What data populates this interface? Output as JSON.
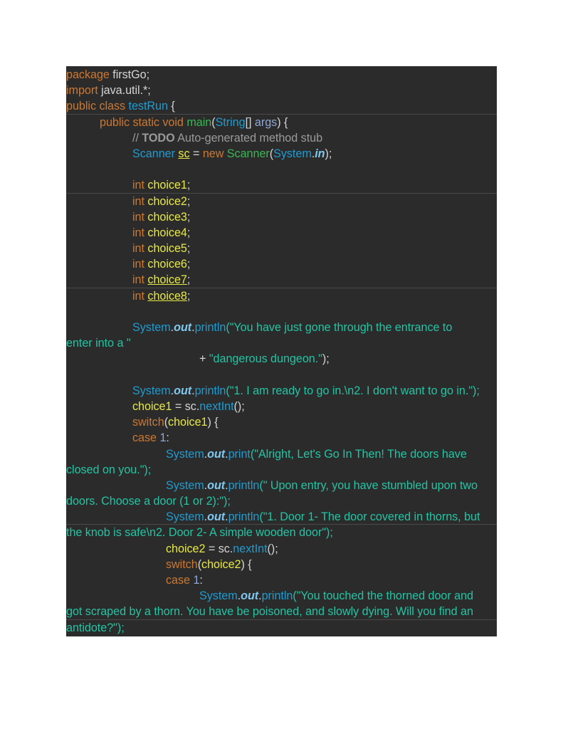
{
  "code": {
    "l01": {
      "kw": "package",
      "rest": " firstGo;"
    },
    "l02": {
      "kw": "import",
      "rest": " java.util.*;"
    },
    "l03": {
      "kw": "public class",
      "cls": " testRun",
      "rest": " {"
    },
    "l04": {
      "kw": "public static void",
      "m": " main",
      "p1": "(",
      "ty": "String",
      "p2": "[] ",
      "arg": "args",
      "p3": ") {"
    },
    "l05": {
      "c1": "// ",
      "todo": "TODO",
      "c2": " Auto-generated method stub"
    },
    "l06": {
      "ty": "Scanner",
      "sp": " ",
      "var": "sc",
      "eq": " = ",
      "kw": "new",
      "m": " Scanner",
      "p1": "(",
      "sys": "System",
      "dot": ".",
      "in": "in",
      "p2": ");"
    },
    "choices": [
      {
        "kw": "int",
        "var": "choice1",
        "semi": ";"
      },
      {
        "kw": "int",
        "var": "choice2",
        "semi": ";"
      },
      {
        "kw": "int",
        "var": "choice3",
        "semi": ";"
      },
      {
        "kw": "int",
        "var": "choice4",
        "semi": ";"
      },
      {
        "kw": "int",
        "var": "choice5",
        "semi": ";"
      },
      {
        "kw": "int",
        "var": "choice6",
        "semi": ";"
      },
      {
        "kw": "int",
        "var": "choice7",
        "semi": ";"
      },
      {
        "kw": "int",
        "var": "choice8",
        "semi": ";"
      }
    ],
    "sys": "System",
    "dot": ".",
    "out": "out",
    "println": "println",
    "print": "print",
    "l16a": "(\"You have just gone through the entrance to",
    "l16b": "enter into a \"",
    "l16c_plus": "+ ",
    "l16c_str": "\"dangerous dungeon.\"",
    "l16c_end": ");",
    "l19": "(\"1. I am ready to go in.\\n2. I don't want to go in.\");",
    "l20": {
      "var": "choice1",
      "eq": " = sc.",
      "m": "nextInt",
      "end": "();"
    },
    "l21": {
      "kw": "switch",
      "p1": "(",
      "var": "choice1",
      "p2": ") {"
    },
    "l22": {
      "kw": "case",
      "num": " 1",
      "colon": ":"
    },
    "l23a": "(\"Alright, Let's Go In Then! The doors have",
    "l23b": "closed on you.\");",
    "l25a": "(\" Upon entry, you have stumbled upon two",
    "l25b": "doors. Choose a door (1 or 2):\");",
    "l27a": "(\"1. Door 1- The door covered in thorns, but",
    "l27b": "the knob is safe\\n2. Door 2- A simple wooden door\");",
    "l29": {
      "var": "choice2",
      "eq": " = sc.",
      "m": "nextInt",
      "end": "();"
    },
    "l30": {
      "kw": "switch",
      "p1": "(",
      "var": "choice2",
      "p2": ") {"
    },
    "l31": {
      "kw": "case",
      "num": " 1",
      "colon": ":"
    },
    "l32a": "(\"You touched the thorned door and",
    "l32b": "got scraped by a thorn. You have be poisoned, and slowly dying. Will you find an",
    "l32c": "antidote?\");"
  }
}
